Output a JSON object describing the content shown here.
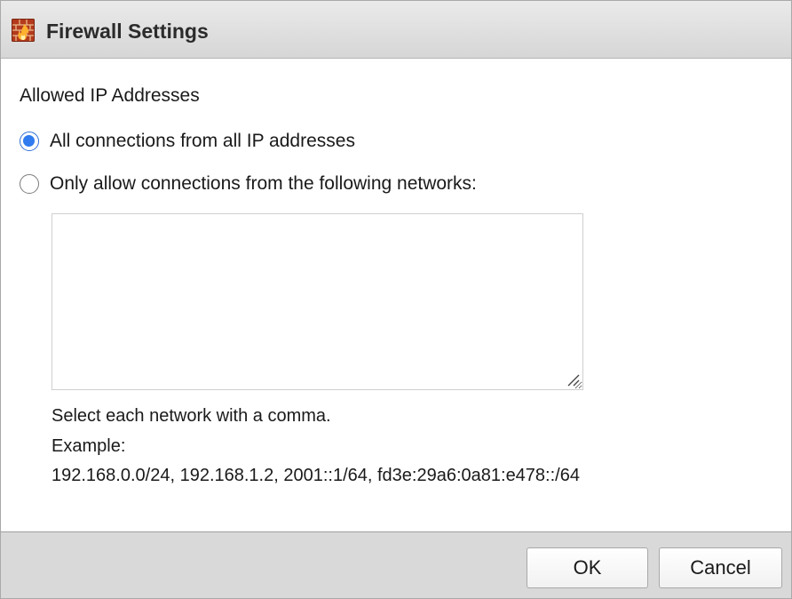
{
  "dialog": {
    "title": "Firewall Settings",
    "icon": "firewall-icon"
  },
  "allowed_ip": {
    "section_label": "Allowed IP Addresses",
    "options": [
      {
        "label": "All connections from all IP addresses",
        "checked": true
      },
      {
        "label": "Only allow connections from the following networks:",
        "checked": false
      }
    ],
    "networks_value": "",
    "help_lines": [
      "Select each network with a comma.",
      "Example:",
      "192.168.0.0/24, 192.168.1.2, 2001::1/64, fd3e:29a6:0a81:e478::/64"
    ]
  },
  "footer": {
    "ok_label": "OK",
    "cancel_label": "Cancel"
  },
  "colors": {
    "accent": "#2f7bef",
    "titlebar": "#dcdcdc",
    "footer": "#d9d9d9"
  }
}
